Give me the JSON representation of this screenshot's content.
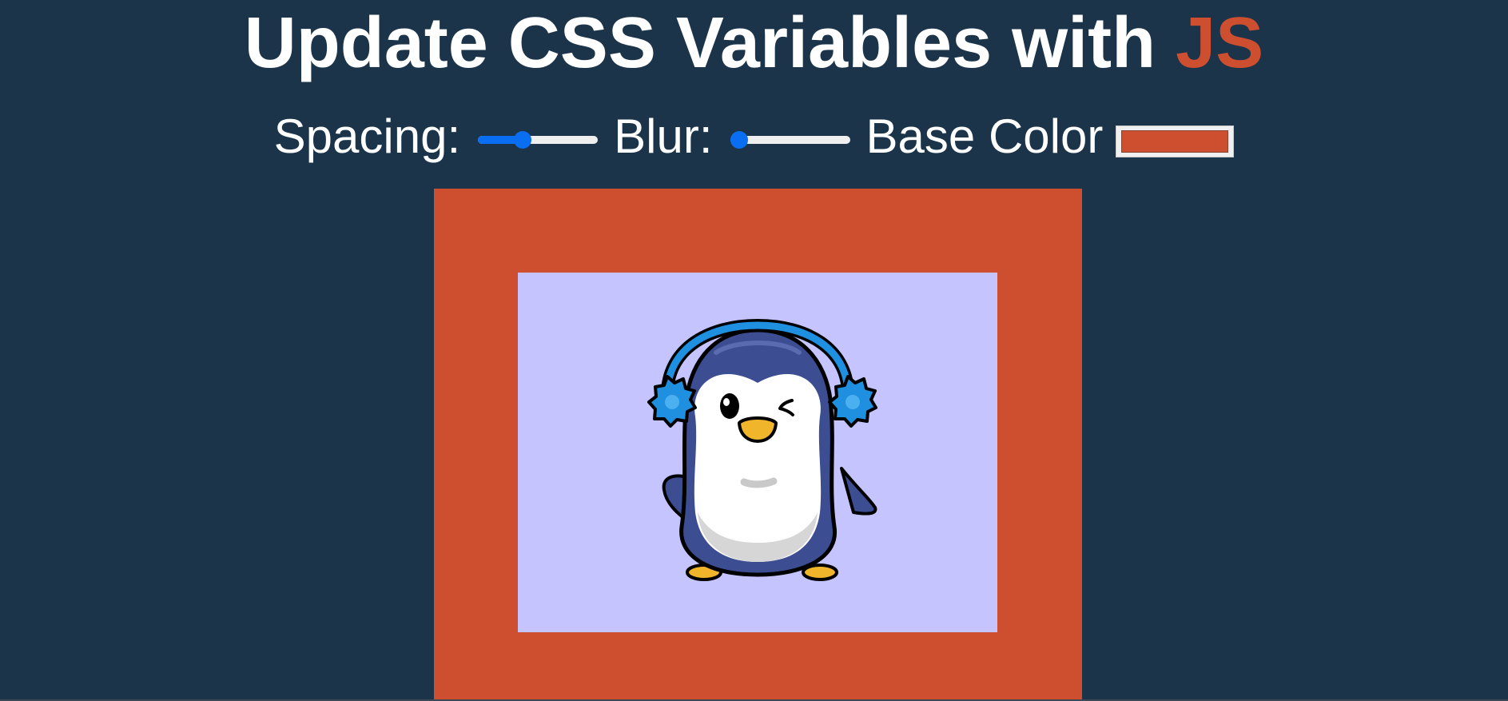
{
  "title": {
    "text": "Update CSS Variables with ",
    "highlight": "JS",
    "highlight_color": "#cd4f2f"
  },
  "controls": {
    "spacing": {
      "label": "Spacing:",
      "value": 0.35
    },
    "blur": {
      "label": "Blur:",
      "value": 0
    },
    "base_color": {
      "label": "Base Color",
      "value": "#cd4f2f"
    }
  },
  "colors": {
    "background": "#1b344a",
    "frame": "#cd4f2f",
    "picture_background": "#c6c4fe",
    "slider_accent": "#0a6ef2"
  },
  "image": {
    "subject": "penguin-with-earmuffs-icon"
  }
}
